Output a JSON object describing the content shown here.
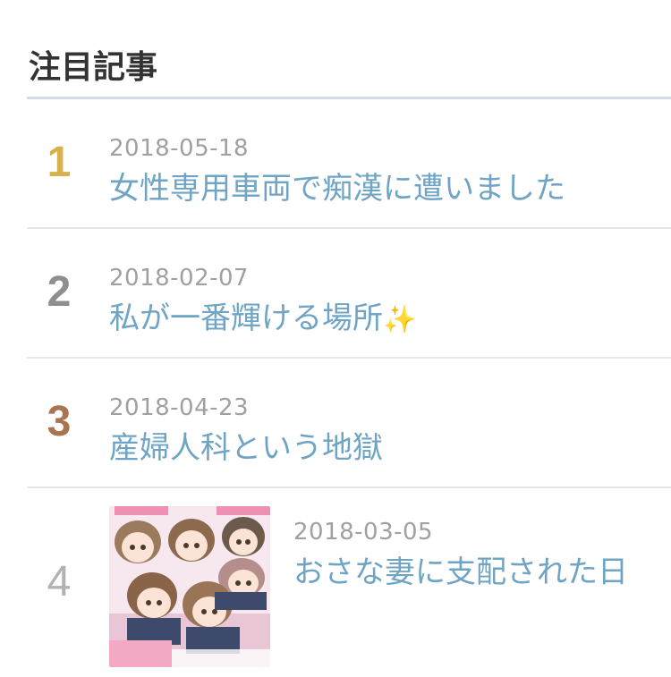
{
  "widget": {
    "heading": "注目記事"
  },
  "articles": [
    {
      "rank": "1",
      "date": "2018-05-18",
      "title": "女性専用車両で痴漢に遭いました",
      "rank_color": "#d7b24b"
    },
    {
      "rank": "2",
      "date": "2018-02-07",
      "title": "私が一番輝ける場所",
      "title_emoji": "✨",
      "rank_color": "#8e8e8e"
    },
    {
      "rank": "3",
      "date": "2018-04-23",
      "title": "産婦人科という地獄",
      "rank_color": "#a87550"
    },
    {
      "rank": "4",
      "date": "2018-03-05",
      "title": "おさな妻に支配された日",
      "rank_color": "#b2b2b2",
      "thumbnail": "manga-cover-thumbnail"
    }
  ],
  "colors": {
    "link": "#6fa4c4",
    "date": "#a0a0a0",
    "heading": "#333333",
    "divider": "#e3e6ea"
  }
}
